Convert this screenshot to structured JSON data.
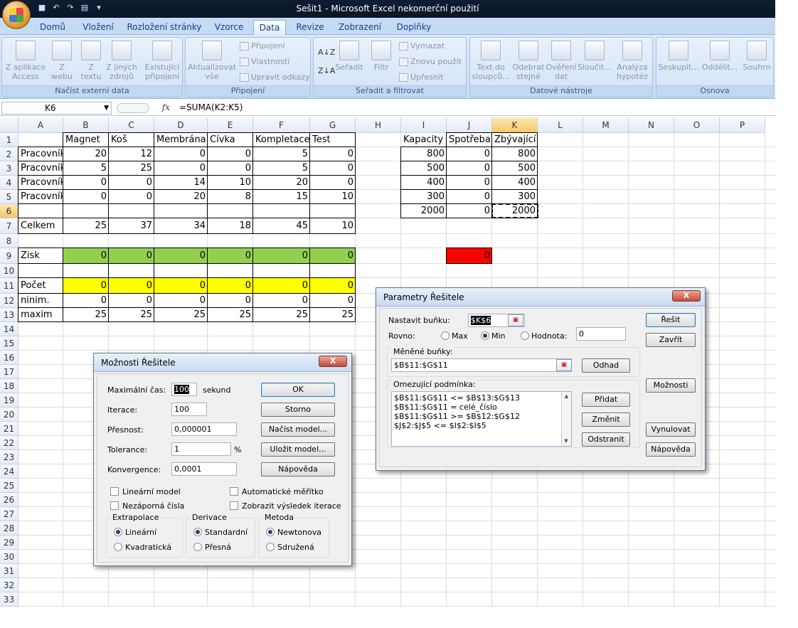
{
  "window": {
    "title": "Sešit1 - Microsoft Excel nekomerční použití"
  },
  "tabs": [
    "Domů",
    "Vložení",
    "Rozložení stránky",
    "Vzorce",
    "Data",
    "Revize",
    "Zobrazení",
    "Doplňky"
  ],
  "active_tab": "Data",
  "ribbon": {
    "groups": [
      "Načíst externí data",
      "Připojení",
      "Seřadit a filtrovat",
      "Datové nástroje",
      "Osnova"
    ],
    "external": [
      "Z aplikace Access",
      "Z webu",
      "Z textu",
      "Z jiných zdrojů",
      "Existující připojení"
    ],
    "connections": {
      "refresh": "Aktualizovat vše",
      "conn": "Připojení",
      "props": "Vlastnosti",
      "links": "Upravit odkazy"
    },
    "sort": {
      "sort": "Seřadit",
      "filter": "Filtr",
      "clear": "Vymazat",
      "reapply": "Znovu použít",
      "advanced": "Upřesnit"
    },
    "tools": [
      "Text do sloupců...",
      "Odebrat stejné",
      "Ověření dat",
      "Sloučit...",
      "Analýza hypotéz"
    ],
    "outline": [
      "Seskupit...",
      "Oddělit...",
      "Souhrn"
    ]
  },
  "formula_bar": {
    "name_box": "K6",
    "fx": "fx",
    "formula": "=SUMA(K2:K5)"
  },
  "columns": [
    "A",
    "B",
    "C",
    "D",
    "E",
    "F",
    "G",
    "H",
    "I",
    "J",
    "K",
    "L",
    "M",
    "N",
    "O",
    "P"
  ],
  "rows": [
    "1",
    "2",
    "3",
    "4",
    "5",
    "6",
    "7",
    "8",
    "9",
    "10",
    "11",
    "12",
    "13",
    "14",
    "15",
    "16",
    "17",
    "18",
    "19",
    "20",
    "21",
    "22",
    "23",
    "24",
    "25",
    "26",
    "27",
    "28",
    "29",
    "30",
    "31",
    "32",
    "33"
  ],
  "table_headers": [
    "Magnet",
    "Koš",
    "Membrána",
    "Cívka",
    "Kompletace",
    "Test"
  ],
  "table_rows": [
    {
      "label": "Pracovník",
      "values": [
        "20",
        "12",
        "0",
        "0",
        "5",
        "0"
      ]
    },
    {
      "label": "Pracovník",
      "values": [
        "5",
        "25",
        "0",
        "0",
        "5",
        "0"
      ]
    },
    {
      "label": "Pracovník",
      "values": [
        "0",
        "0",
        "14",
        "10",
        "20",
        "0"
      ]
    },
    {
      "label": "Pracovník",
      "values": [
        "0",
        "0",
        "20",
        "8",
        "15",
        "10"
      ]
    }
  ],
  "celkem": {
    "label": "Celkem",
    "values": [
      "25",
      "37",
      "34",
      "18",
      "45",
      "10"
    ]
  },
  "zisk": {
    "label": "Zisk",
    "values": [
      "0",
      "0",
      "0",
      "0",
      "0",
      "0"
    ]
  },
  "pocet": {
    "label": "Počet",
    "values": [
      "0",
      "0",
      "0",
      "0",
      "0",
      "0"
    ]
  },
  "minim": {
    "label": "ninim.",
    "values": [
      "0",
      "0",
      "0",
      "0",
      "0",
      "0"
    ]
  },
  "maxim": {
    "label": "maxim",
    "values": [
      "25",
      "25",
      "25",
      "25",
      "25",
      "25"
    ]
  },
  "capacity_headers": [
    "Kapacity",
    "Spotřeba",
    "Zbývající"
  ],
  "capacity_rows": [
    [
      "800",
      "0",
      "800"
    ],
    [
      "500",
      "0",
      "500"
    ],
    [
      "400",
      "0",
      "400"
    ],
    [
      "300",
      "0",
      "300"
    ],
    [
      "2000",
      "0",
      "2000"
    ]
  ],
  "j9_value": "0",
  "colors": {
    "zisk": "#92d050",
    "pocet": "#ffff00",
    "j9": "#ff0000",
    "ribbon": "#c5daf3"
  },
  "solver_params": {
    "title": "Parametry Řešitele",
    "close": "X",
    "set_cell_label": "Nastavit buňku:",
    "set_cell": "$K$6",
    "equal_label": "Rovno:",
    "max": "Max",
    "min": "Min",
    "value": "Hodnota:",
    "value_input": "0",
    "changing_label": "Měněné buňky:",
    "changing": "$B$11:$G$11",
    "guess": "Odhad",
    "constraints_label": "Omezující podmínka:",
    "constraints": [
      "$B$11:$G$11 <= $B$13:$G$13",
      "$B$11:$G$11 = celé_číslo",
      "$B$11:$G$11 >= $B$12:$G$12",
      "$J$2:$J$5 <= $I$2:$I$5"
    ],
    "add": "Přidat",
    "change": "Změnit",
    "delete": "Odstranit",
    "solve": "Řešit",
    "close_btn": "Zavřít",
    "options": "Možnosti",
    "reset": "Vynulovat",
    "help": "Nápověda"
  },
  "solver_options": {
    "title": "Možnosti Řešitele",
    "close": "X",
    "max_time_label": "Maximální čas:",
    "max_time": "100",
    "seconds": "sekund",
    "iter_label": "Iterace:",
    "iter": "100",
    "precision_label": "Přesnost:",
    "precision": "0,000001",
    "tolerance_label": "Tolerance:",
    "tolerance": "1",
    "percent": "%",
    "conv_label": "Konvergence:",
    "conv": "0,0001",
    "ok": "OK",
    "cancel": "Storno",
    "load": "Načíst model...",
    "save": "Uložit model...",
    "help": "Nápověda",
    "linear": "Lineární model",
    "nonneg": "Nezáporná čísla",
    "autoscale": "Automatické měřítko",
    "show_iter": "Zobrazit výsledek iterace",
    "extrap_label": "Extrapolace",
    "extrap": [
      "Lineární",
      "Kvadratická"
    ],
    "deriv_label": "Derivace",
    "deriv": [
      "Standardní",
      "Přesná"
    ],
    "method_label": "Metoda",
    "method": [
      "Newtonova",
      "Sdružená"
    ]
  }
}
